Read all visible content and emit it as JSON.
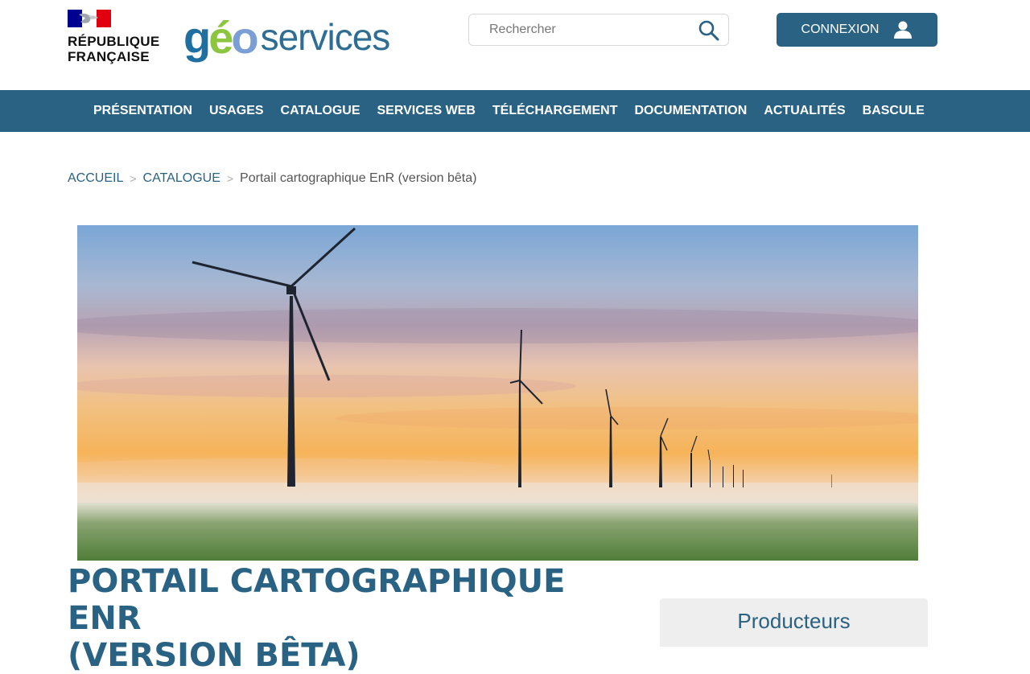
{
  "header": {
    "republic_line1": "RÉPUBLIQUE",
    "republic_line2": "FRANÇAISE",
    "logo_geo": [
      "g",
      "é",
      "o"
    ],
    "logo_services": "services",
    "search_placeholder": "Rechercher",
    "connexion_label": "CONNEXION"
  },
  "nav": {
    "items": [
      "PRÉSENTATION",
      "USAGES",
      "CATALOGUE",
      "SERVICES WEB",
      "TÉLÉCHARGEMENT",
      "DOCUMENTATION",
      "ACTUALITÉS",
      "BASCULE"
    ]
  },
  "breadcrumb": {
    "home": "ACCUEIL",
    "catalogue": "CATALOGUE",
    "current": "Portail cartographique EnR (version bêta)"
  },
  "page": {
    "title_line1": "PORTAIL CARTOGRAPHIQUE ENR",
    "title_line2": "(VERSION BÊTA)",
    "producers_label": "Producteurs"
  },
  "colors": {
    "brand_blue": "#2a6283",
    "logo_green": "#8cc63f",
    "logo_blue": "#1f6fa0"
  }
}
